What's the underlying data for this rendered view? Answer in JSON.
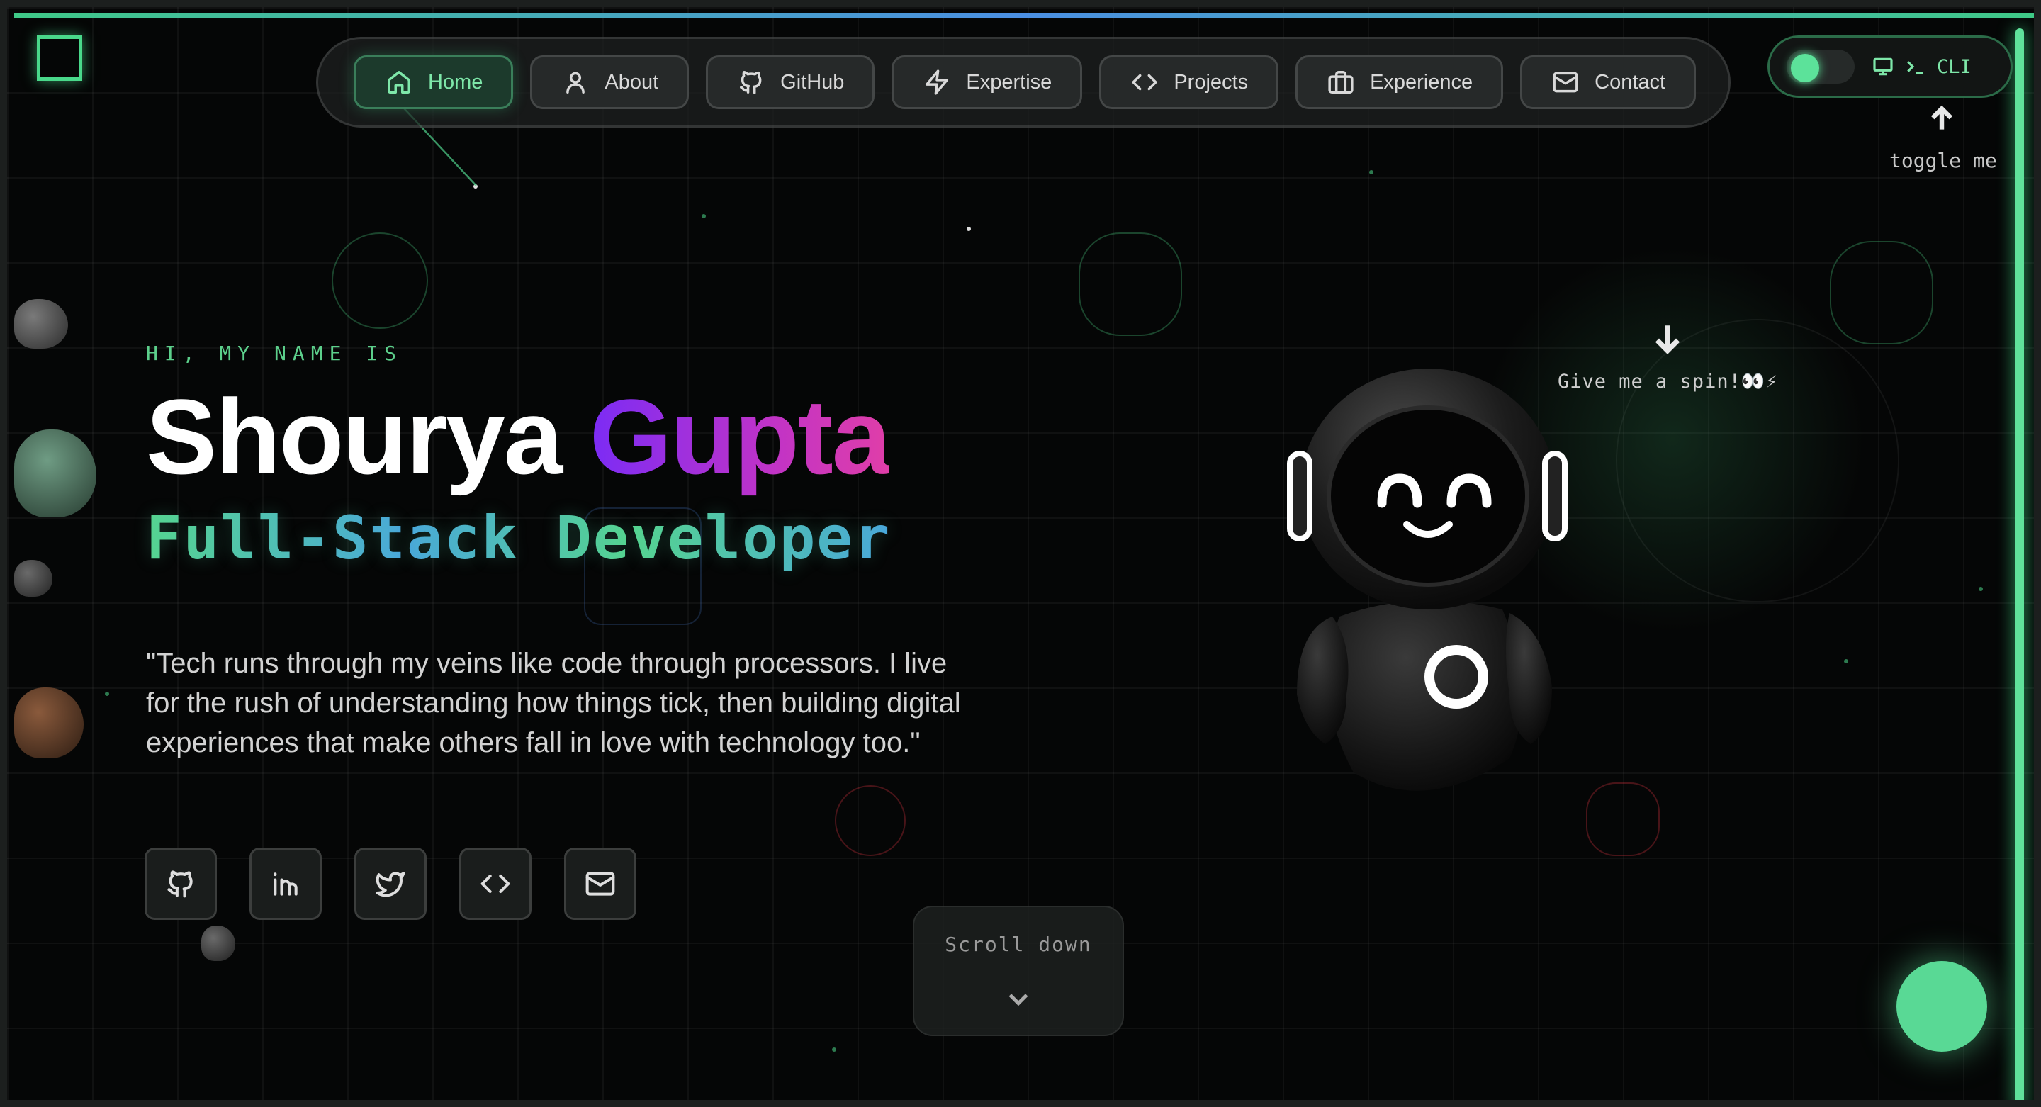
{
  "nav": {
    "items": [
      {
        "label": "Home",
        "icon": "home-icon"
      },
      {
        "label": "About",
        "icon": "user-icon"
      },
      {
        "label": "GitHub",
        "icon": "github-icon"
      },
      {
        "label": "Expertise",
        "icon": "lightning-icon"
      },
      {
        "label": "Projects",
        "icon": "code-icon"
      },
      {
        "label": "Experience",
        "icon": "briefcase-icon"
      },
      {
        "label": "Contact",
        "icon": "mail-icon"
      }
    ],
    "active": "Home"
  },
  "cli_toggle": {
    "label": "CLI",
    "hint": "toggle me"
  },
  "hero": {
    "greeting": "HI, MY NAME IS",
    "first_name": "Shourya",
    "last_name": "Gupta",
    "role": "Full-Stack Developer",
    "quote": "\"Tech runs through my veins like code through processors. I live for the rush of understanding how things tick, then building digital experiences that make others fall in love with technology too.\""
  },
  "socials": [
    {
      "icon": "github-icon"
    },
    {
      "icon": "linkedin-icon"
    },
    {
      "icon": "twitter-icon"
    },
    {
      "icon": "code-icon"
    },
    {
      "icon": "mail-icon"
    }
  ],
  "scroll": {
    "label": "Scroll down"
  },
  "robot": {
    "hint": "Give me a spin!👀⚡"
  },
  "colors": {
    "accent": "#5ce29a",
    "name_gradient_start": "#7b2cf5",
    "name_gradient_end": "#e03ea8",
    "background": "#050606"
  }
}
